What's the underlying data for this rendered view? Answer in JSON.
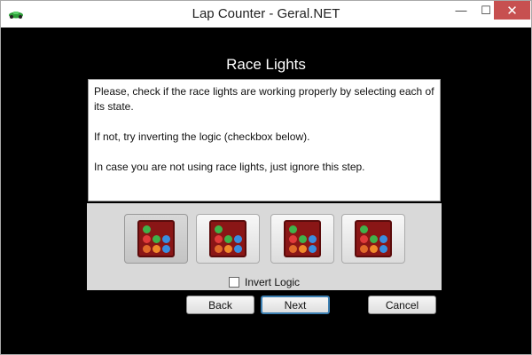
{
  "window": {
    "title": "Lap Counter - Geral.NET",
    "controls": {
      "minimize": "—",
      "maximize": "☐",
      "close": "✕"
    }
  },
  "heading": "Race Lights",
  "message": {
    "line1": "Please, check if the race lights are working properly by selecting each of its state.",
    "line2": "If not, try inverting the logic (checkbox below).",
    "line3": "In case you are not using race lights, just ignore this step."
  },
  "lights": {
    "selected_index": 0,
    "button_icon": "race-lights-icon",
    "dot_colors": [
      "#3fb24a",
      "#ffffff00",
      "#ffffff00",
      "#e03a3a",
      "#3fb24a",
      "#3a8ee0",
      "#e06a2a",
      "#f08a2a",
      "#3a8ee0"
    ]
  },
  "invert_logic": {
    "label": "Invert Logic",
    "checked": false
  },
  "buttons": {
    "back": "Back",
    "next": "Next",
    "cancel": "Cancel"
  }
}
